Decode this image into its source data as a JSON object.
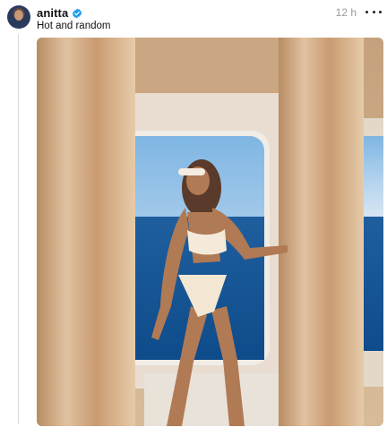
{
  "post": {
    "username": "anitta",
    "timestamp": "12 h",
    "caption": "Hot and random"
  },
  "icons": {
    "verified": "verified-badge-icon",
    "more": "more-options-icon"
  },
  "colors": {
    "verified": "#1d9bf0",
    "text": "#111111",
    "muted": "#9a9a9a"
  }
}
